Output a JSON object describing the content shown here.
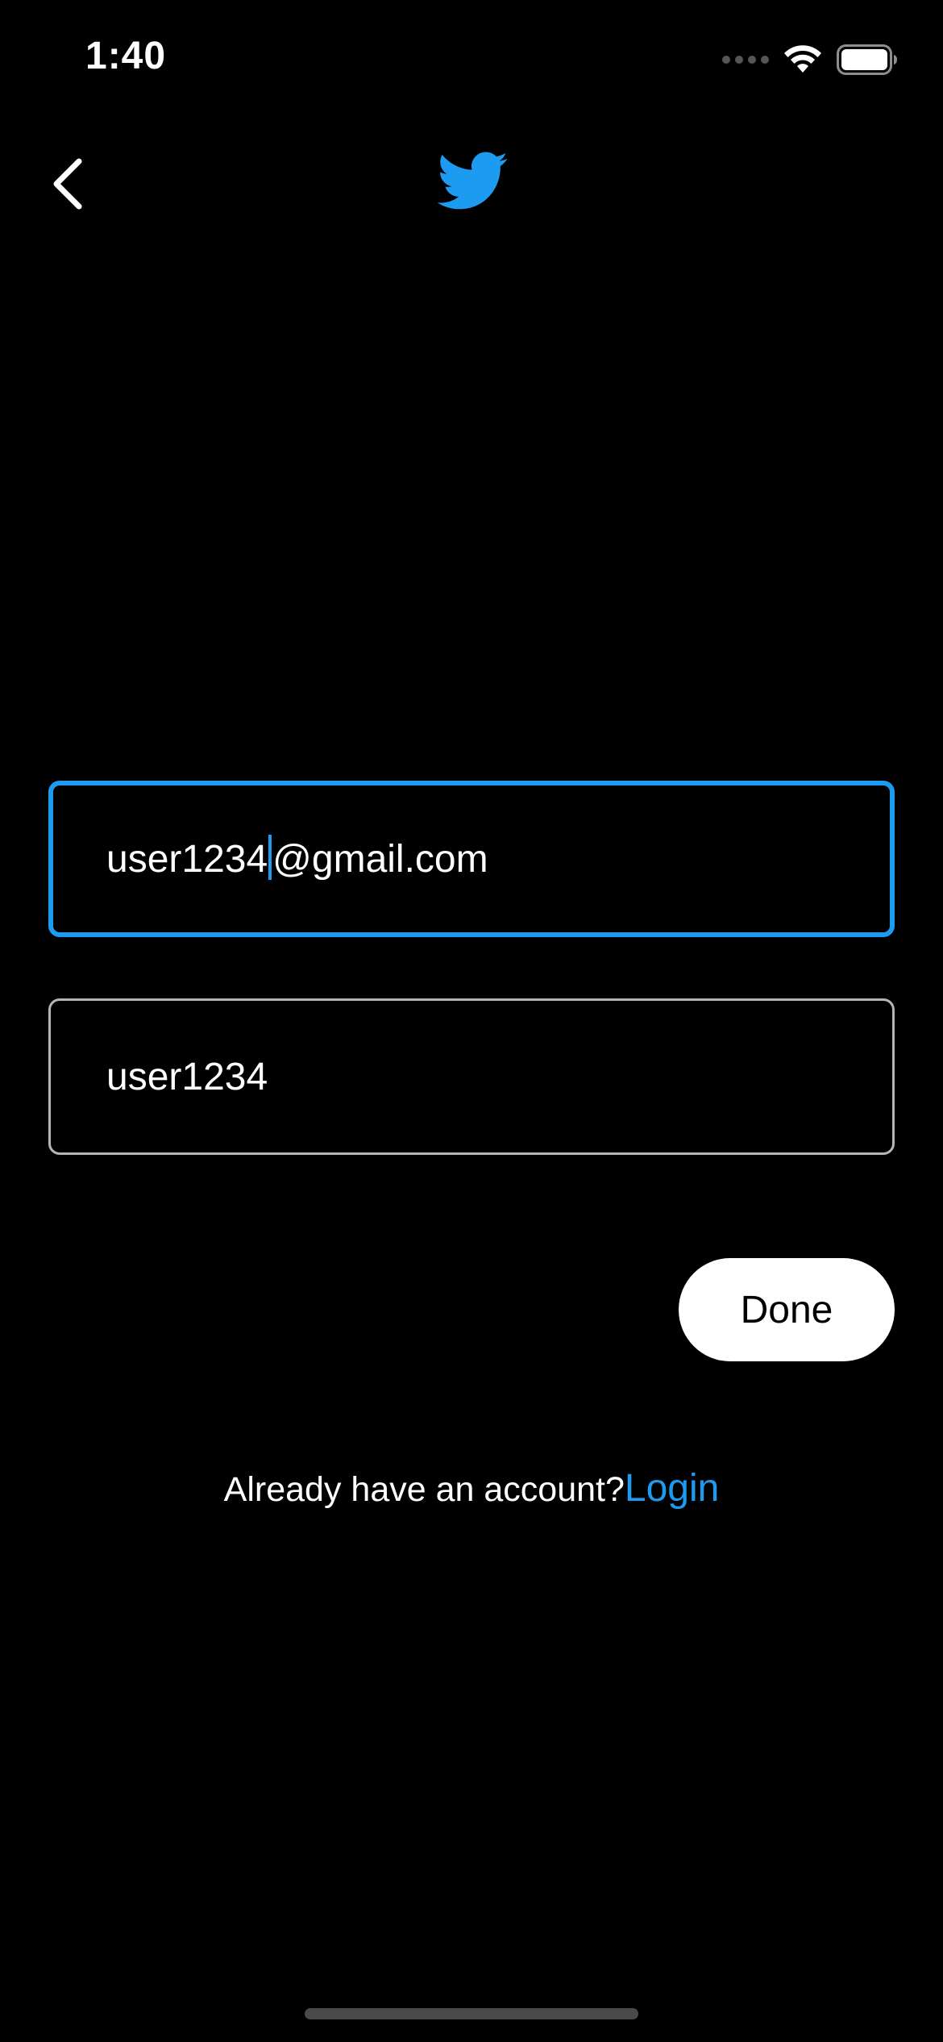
{
  "status_bar": {
    "time": "1:40"
  },
  "form": {
    "email_value_before_caret": "user1234",
    "email_value_after_caret": "@gmail.com",
    "username_value": "user1234"
  },
  "actions": {
    "done_label": "Done"
  },
  "footer": {
    "prompt": "Already have an account?",
    "login_label": "Login"
  },
  "colors": {
    "accent": "#1d9bf0",
    "background": "#000000",
    "text": "#ffffff"
  },
  "icons": {
    "back": "chevron-left-icon",
    "logo": "bird-logo-icon",
    "wifi": "wifi-icon",
    "battery": "battery-icon"
  }
}
